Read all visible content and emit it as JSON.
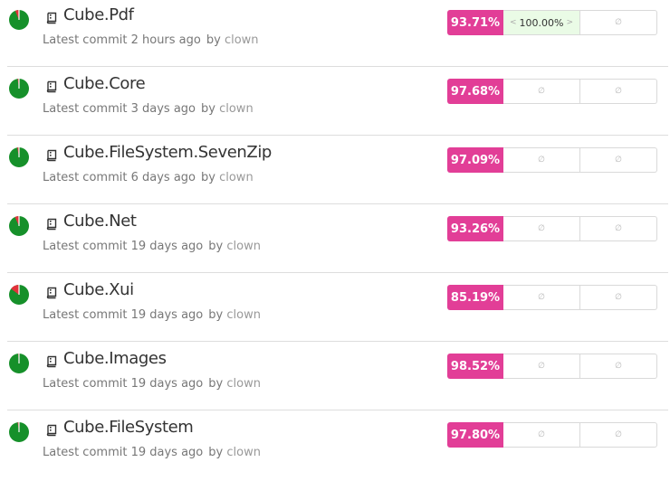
{
  "colors": {
    "coverage_badge": "#e23e97",
    "pie_covered": "#16902a",
    "pie_uncovered": "#e2313a",
    "diff_positive_bg": "#eafbe6"
  },
  "repo_icon": "repo-book-icon",
  "empty_marker_icon": "empty-set-icon",
  "commit_prefix": "Latest commit",
  "by_label": "by",
  "repos": [
    {
      "name": "Cube.Pdf",
      "commit_age": "2 hours ago",
      "author": "clown",
      "coverage_label": "93.71%",
      "coverage": 93.71,
      "diff": {
        "prefix": "<",
        "value": "100.00%",
        "suffix": ">"
      },
      "cell_3": "∅"
    },
    {
      "name": "Cube.Core",
      "commit_age": "3 days ago",
      "author": "clown",
      "coverage_label": "97.68%",
      "coverage": 97.68,
      "cell_2": "∅",
      "cell_3": "∅"
    },
    {
      "name": "Cube.FileSystem.SevenZip",
      "commit_age": "6 days ago",
      "author": "clown",
      "coverage_label": "97.09%",
      "coverage": 97.09,
      "cell_2": "∅",
      "cell_3": "∅"
    },
    {
      "name": "Cube.Net",
      "commit_age": "19 days ago",
      "author": "clown",
      "coverage_label": "93.26%",
      "coverage": 93.26,
      "cell_2": "∅",
      "cell_3": "∅"
    },
    {
      "name": "Cube.Xui",
      "commit_age": "19 days ago",
      "author": "clown",
      "coverage_label": "85.19%",
      "coverage": 85.19,
      "cell_2": "∅",
      "cell_3": "∅"
    },
    {
      "name": "Cube.Images",
      "commit_age": "19 days ago",
      "author": "clown",
      "coverage_label": "98.52%",
      "coverage": 98.52,
      "cell_2": "∅",
      "cell_3": "∅"
    },
    {
      "name": "Cube.FileSystem",
      "commit_age": "19 days ago",
      "author": "clown",
      "coverage_label": "97.80%",
      "coverage": 97.8,
      "cell_2": "∅",
      "cell_3": "∅"
    }
  ]
}
